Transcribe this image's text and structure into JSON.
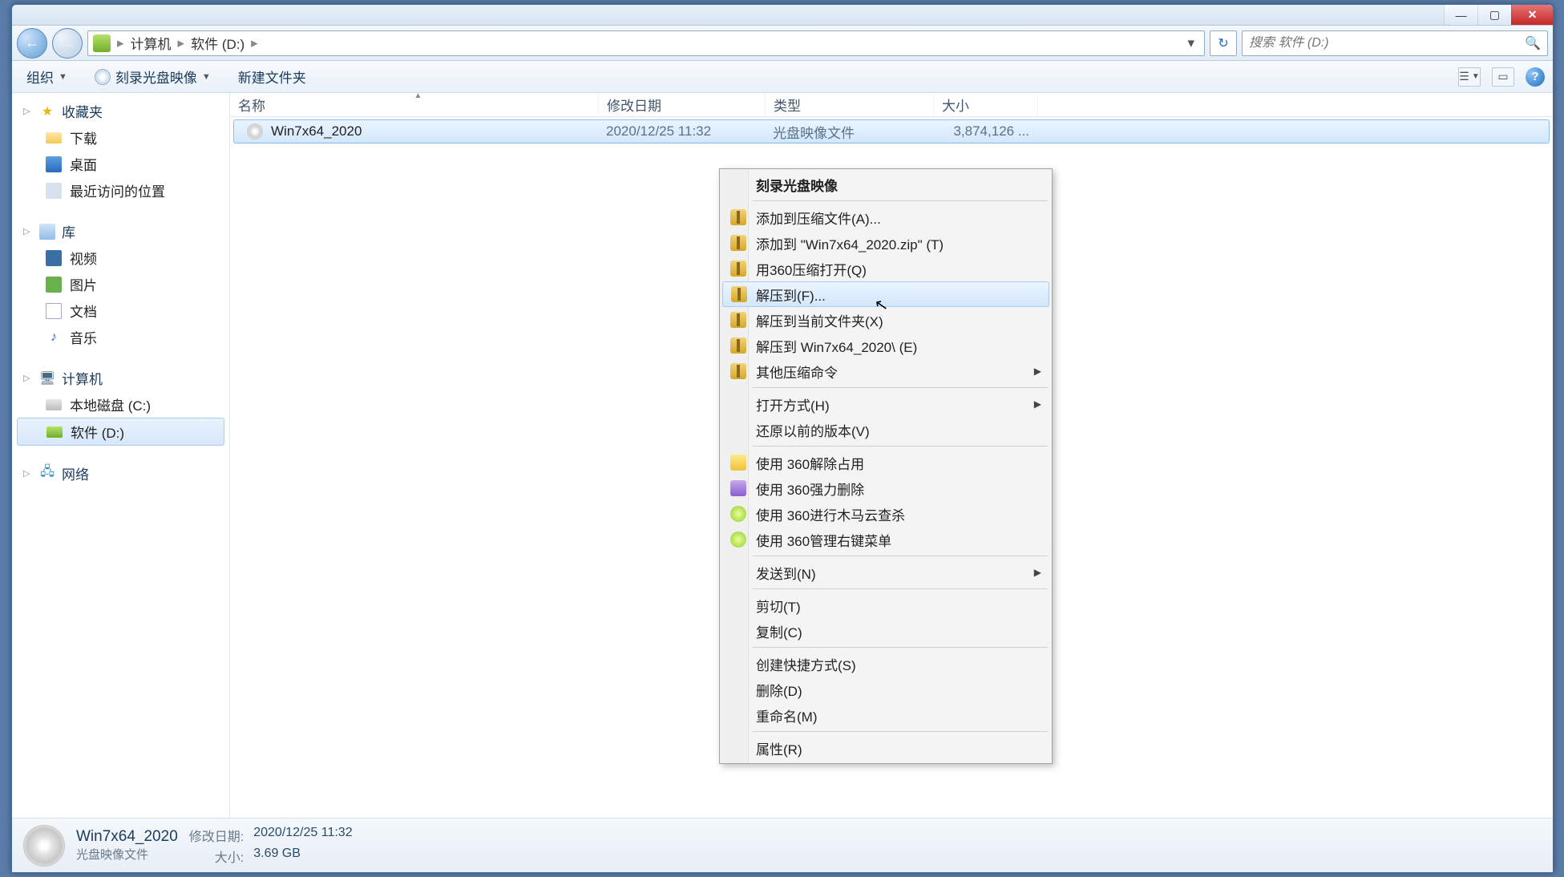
{
  "titlebar": {
    "min": "—",
    "max": "▢",
    "close": "✕"
  },
  "nav": {
    "back": "←",
    "fwd": "→",
    "refresh": "↻"
  },
  "breadcrumb": {
    "root": "计算机",
    "sep": "▸",
    "current": "软件 (D:)"
  },
  "search": {
    "placeholder": "搜索 软件 (D:)"
  },
  "toolbar": {
    "organize": "组织",
    "burn": "刻录光盘映像",
    "newfolder": "新建文件夹",
    "view1": "☰",
    "view2": "▭",
    "help": "?"
  },
  "sidebar": {
    "fav": "收藏夹",
    "fav_items": [
      "下载",
      "桌面",
      "最近访问的位置"
    ],
    "lib": "库",
    "lib_items": [
      "视频",
      "图片",
      "文档",
      "音乐"
    ],
    "comp": "计算机",
    "comp_items": [
      "本地磁盘 (C:)",
      "软件 (D:)"
    ],
    "net": "网络"
  },
  "columns": {
    "name": "名称",
    "date": "修改日期",
    "type": "类型",
    "size": "大小"
  },
  "files": [
    {
      "name": "Win7x64_2020",
      "date": "2020/12/25 11:32",
      "type": "光盘映像文件",
      "size": "3,874,126 ..."
    }
  ],
  "context_menu": {
    "burn": "刻录光盘映像",
    "add_archive": "添加到压缩文件(A)...",
    "add_zip": "添加到 \"Win7x64_2020.zip\" (T)",
    "open_360zip": "用360压缩打开(Q)",
    "extract_to": "解压到(F)...",
    "extract_here": "解压到当前文件夹(X)",
    "extract_named": "解压到 Win7x64_2020\\ (E)",
    "other_zip": "其他压缩命令",
    "open_with": "打开方式(H)",
    "restore_prev": "还原以前的版本(V)",
    "unlock360": "使用 360解除占用",
    "force_del360": "使用 360强力删除",
    "scan360": "使用 360进行木马云查杀",
    "manage_menu360": "使用 360管理右键菜单",
    "send_to": "发送到(N)",
    "cut": "剪切(T)",
    "copy": "复制(C)",
    "shortcut": "创建快捷方式(S)",
    "delete": "删除(D)",
    "rename": "重命名(M)",
    "properties": "属性(R)"
  },
  "statusbar": {
    "title": "Win7x64_2020",
    "subtitle": "光盘映像文件",
    "date_label": "修改日期:",
    "date_value": "2020/12/25 11:32",
    "size_label": "大小:",
    "size_value": "3.69 GB"
  }
}
